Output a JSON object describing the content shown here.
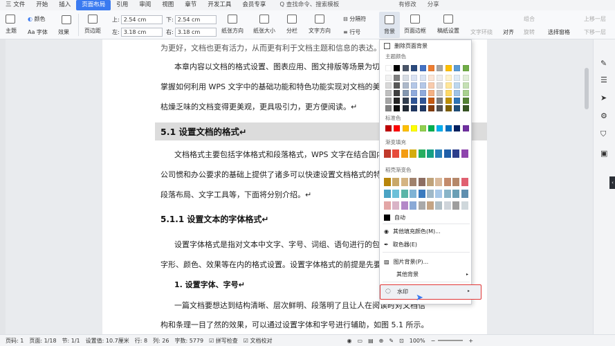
{
  "menubar": {
    "items": [
      "三 文件",
      "开始",
      "插入",
      "页面布局",
      "引用",
      "审阅",
      "视图",
      "章节",
      "开发工具",
      "会员专享"
    ],
    "active_index": 3,
    "search_label": "Q 查找命令、搜索模板",
    "changes_label": "有修改",
    "share_label": "分享"
  },
  "ribbon": {
    "theme": "主题",
    "colors": "颜色",
    "font": "Aa 字体",
    "effects": "效果",
    "margins": "页边距",
    "top_label": "上:",
    "top_value": "2.54 cm",
    "bottom_label": "下:",
    "bottom_value": "2.54 cm",
    "left_label": "左:",
    "left_value": "3.18 cm",
    "right_label": "右:",
    "right_value": "3.18 cm",
    "orientation": "纸张方向",
    "size": "纸张大小",
    "columns": "分栏",
    "direction": "文字方向",
    "line_numbers": "行号",
    "separator": "分隔符",
    "background": "背景",
    "page_border": "页面边框",
    "paper_settings": "稿纸设置",
    "text_wrap": "文字环绕",
    "align": "对齐",
    "rotate": "旋转",
    "select_pane": "选择窗格",
    "group": "组合",
    "move_up": "上移一层",
    "move_down": "下移一层"
  },
  "document": {
    "lines": [
      "为更好，文档也更有活力，从而更有利于文档主题和信息的表达。",
      "本章内容以文档的格式设置、图表应用、图文排版等场景为切",
      "掌握如何利用 WPS 文字中的基础功能和特色功能实现对文档的美",
      "枯燥乏味的文档变得更美观，更具吸引力，更方便阅读。↵",
      "5.1 设置文档的格式↵",
      "文档格式主要包括字体格式和段落格式，WPS 文字在结合国内",
      "公司惯和办公要求的基础上提供了诸多可以快速设置文档格式的特",
      "段落布局、文字工具等，下面将分别介绍。↵",
      "5.1.1 设置文本的字体格式↵",
      "设置字体格式是指对文本中文字、字号、词组、语句进行的包括",
      "字形、颜色、效果等在内的格式设置。设置字体格式的前提是先要",
      "1. 设置字体、字号↵",
      "一篇文档要想达到结构清晰、层次鲜明、段落明了且让人在阅读时对文档信",
      "构和条理一目了然的效果，可以通过设置字体和字号进行辅助，如图 5.1 所示。"
    ]
  },
  "dropdown": {
    "remove_bg": "删除页面背景",
    "theme_colors_label": "主题颜色",
    "standard_colors_label": "标准色",
    "gradient_fill_label": "渐变填充",
    "texture_gradient_label": "稻壳渐变色",
    "auto": "自动",
    "more_fill": "其他填充颜色(M)...",
    "eyedropper": "取色器(E)",
    "picture_bg": "图片背景(P)...",
    "other_bg": "其他背景",
    "watermark": "水印",
    "theme_top_row": [
      "#ffffff",
      "#000000",
      "#4a5568",
      "#2b4a7d",
      "#4472c4",
      "#ed7d31",
      "#a5a5a5",
      "#ffc000",
      "#5b9bd5",
      "#70ad47"
    ],
    "theme_shades": [
      [
        "#f2f2f2",
        "#7f7f7f",
        "#d6dce4",
        "#d9e2f3",
        "#dae3f3",
        "#fbe5d6",
        "#ededed",
        "#fff2cc",
        "#deebf7",
        "#e2efda"
      ],
      [
        "#d9d9d9",
        "#595959",
        "#adb9ca",
        "#b4c7e7",
        "#b4c7e7",
        "#f8cbad",
        "#dbdbdb",
        "#ffe699",
        "#bdd7ee",
        "#c5e0b4"
      ],
      [
        "#bfbfbf",
        "#404040",
        "#8497b0",
        "#8faadc",
        "#8faadc",
        "#f4b183",
        "#c9c9c9",
        "#ffd966",
        "#9dc3e6",
        "#a9d18e"
      ],
      [
        "#a6a6a6",
        "#262626",
        "#333f50",
        "#2f5597",
        "#2f5597",
        "#c55a11",
        "#7b7b7b",
        "#bf9000",
        "#2e75b6",
        "#548235"
      ],
      [
        "#808080",
        "#0d0d0d",
        "#222a35",
        "#203864",
        "#1f3864",
        "#843c0c",
        "#525252",
        "#7f6000",
        "#1f4e79",
        "#375623"
      ]
    ],
    "standard": [
      "#c00000",
      "#ff0000",
      "#ffc000",
      "#ffff00",
      "#92d050",
      "#00b050",
      "#00b0f0",
      "#0070c0",
      "#002060",
      "#7030a0"
    ],
    "gradient": [
      "#c0392b",
      "#e74c3c",
      "#f39c12",
      "#d4ac0d",
      "#27ae60",
      "#16a085",
      "#2980b9",
      "#1f5fa8",
      "#2c3e8c",
      "#8e44ad"
    ],
    "texture_rows": [
      [
        "#b8860b",
        "#c9a86a",
        "#d4b483",
        "#a0826d",
        "#8d6e63",
        "#bfa27a",
        "#d9b99b",
        "#c48b6c",
        "#b5886a",
        "#e06070"
      ],
      [
        "#4aa3c4",
        "#6cc0d8",
        "#5bb5a8",
        "#7fb3d5",
        "#3b7bbf",
        "#9fb8c8",
        "#a7c7e7",
        "#88b4c8",
        "#6a9fb5",
        "#5f8faf"
      ],
      [
        "#e3a6a6",
        "#d9b3c6",
        "#b388c8",
        "#8aa9d6",
        "#a9a9a9",
        "#c4a484",
        "#b0bec5",
        "#ced4da",
        "#9e9e9e",
        "#cfd8dc"
      ]
    ]
  },
  "statusbar": {
    "page_no": "页码: 1",
    "pages": "页面: 1/18",
    "section": "节: 1/1",
    "setting": "设置值: 10.7厘米",
    "row": "行: 8",
    "col": "列: 26",
    "words": "字数: 5779",
    "spell": "拼写检查",
    "proof": "文档校对",
    "zoom": "100%"
  }
}
